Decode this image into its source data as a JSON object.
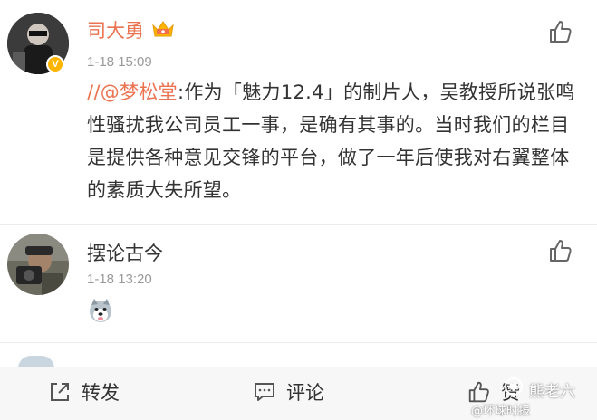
{
  "comment1": {
    "username": "司大勇",
    "crown_icon": "crown-icon",
    "verified_badge": "V",
    "timestamp": "1-18 15:09",
    "mention": "//@梦松堂",
    "body": ":作为「魅力12.4」的制片人，吴教授所说张鸣性骚扰我公司员工一事，是确有其事的。当时我们的栏目是提供各种意见交锋的平台，做了一年后使我对右翼整体的素质大失所望。",
    "like_icon": "thumbs-up-icon"
  },
  "comment2": {
    "username": "摆论古今",
    "timestamp": "1-18 13:20",
    "emoji": "husky-emoji",
    "like_icon": "thumbs-up-icon"
  },
  "bottom_bar": {
    "repost_label": "转发",
    "comment_label": "评论",
    "like_label": "赞"
  },
  "watermark": {
    "text": "熊老六",
    "sub_text": "@环球时报"
  },
  "colors": {
    "username": "#eb7350",
    "mention": "#eb7350",
    "text": "#333333",
    "muted": "#999999",
    "bar_bg": "#f7f7f7"
  }
}
